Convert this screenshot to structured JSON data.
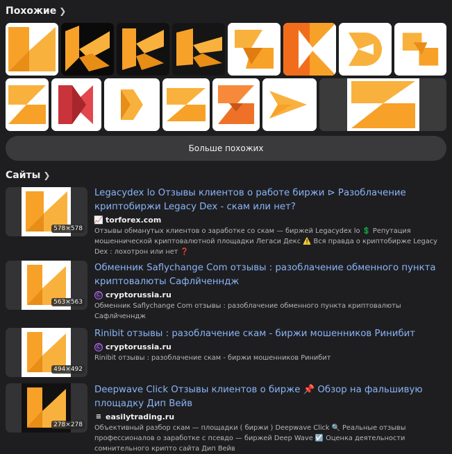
{
  "similar": {
    "title": "Похожие",
    "chevron": "chevron-right-icon",
    "more_button": "Больше похожих"
  },
  "sites": {
    "title": "Сайты",
    "chevron": "chevron-right-icon",
    "results": [
      {
        "title": "Legacydex lo Отзывы клиентов о работе биржи ⊳ Разоблачение криптобиржи Legacy Dex - скам или нет?",
        "site": "torforex.com",
        "favicon": "chart-icon",
        "dimensions": "578×578",
        "snippet": "Отзывы обманутых клиентов о заработке со скам — биржей Legacydex lo 💲 Репутация мошеннической криптовалютной площадки Легаси Декс ⚠️ Вся правда о криптобирже Legacy Dex : лохотрон или нет ❓"
      },
      {
        "title": "Обменник Saflychange Com отзывы : разоблачение обменного пункта криптовалюты Сафлйченндж",
        "site": "cryptorussia.ru",
        "favicon": "crypto-icon",
        "dimensions": "563×563",
        "snippet": "Обменник Saflychange Com отзывы : разоблачение обменного пункта криптовалюты Сафлйченндж"
      },
      {
        "title": "Rinibit отзывы : разоблачение скам - биржи мошенников Ринибит",
        "site": "cryptorussia.ru",
        "favicon": "crypto-icon",
        "dimensions": "494×492",
        "snippet": "Rinibit отзывы : разоблачение скам - биржи мошенников Ринибит"
      },
      {
        "title": "Deepwave Click Отзывы клиентов о бирже 📌 Обзор на фальшивую площадку Дип Вейв",
        "site": "easilytrading.ru",
        "favicon": "bars-icon",
        "dimensions": "278×278",
        "snippet": "Объективный разбор скам — площадки ( биржи ) Deepwave Click 🔍 Реальные отзывы профессионалов о заработке с псевдо — биржей Deep Wave ☑️ Оценка деятельности сомнительного крипто сайта Дип Вейв"
      }
    ]
  },
  "colors": {
    "background": "#1e1e20",
    "link": "#8ab4f8",
    "accent_orange": "#f7a128"
  }
}
